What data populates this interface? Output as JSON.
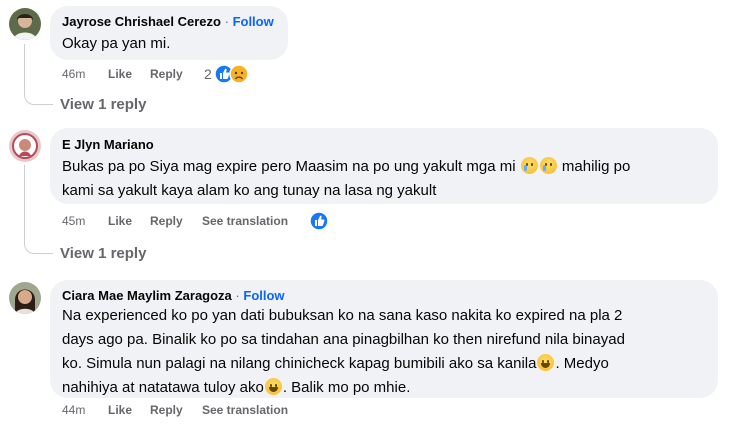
{
  "comments": [
    {
      "author": "Jayrose Chrishael Cerezo",
      "separator": "·",
      "follow_label": "Follow",
      "text": "Okay pa yan mi.",
      "time": "46m",
      "like_label": "Like",
      "reply_label": "Reply",
      "reaction_count": "2",
      "reactions": [
        "like-icon",
        "sad-icon"
      ],
      "view_replies": "View 1 reply"
    },
    {
      "author": "E Jlyn Mariano",
      "text_line1": "Bukas pa po Siya mag expire pero Maasim na po ung yakult mga mi",
      "text_line1_after": "mahilig po",
      "text_line2": "kami sa yakult kaya alam ko ang tunay na lasa ng yakult",
      "time": "45m",
      "like_label": "Like",
      "reply_label": "Reply",
      "translate_label": "See translation",
      "reactions": [
        "like-icon"
      ],
      "view_replies": "View 1 reply"
    },
    {
      "author": "Ciara Mae Maylim Zaragoza",
      "separator": "·",
      "follow_label": "Follow",
      "text_line1": "Na experienced ko po yan dati bubuksan ko na sana kaso nakita ko expired na pla 2",
      "text_line2": "days ago pa. Binalik ko po sa tindahan ana pinagbilhan ko then nirefund nila binayad",
      "text_line3": "ko. Simula nun palagi na nilang chinicheck kapag bumibili ako sa kanila",
      "text_line3_after": ". Medyo",
      "text_line4": "nahihiya at natatawa tuloy ako",
      "text_line4_after": ". Balik mo po mhie.",
      "time": "44m",
      "like_label": "Like",
      "reply_label": "Reply",
      "translate_label": "See translation"
    }
  ],
  "colors": {
    "bubble": "#f0f2f5",
    "link_blue": "#0866ff",
    "meta_gray": "#65676b",
    "thread_line": "#ccd0d5"
  }
}
